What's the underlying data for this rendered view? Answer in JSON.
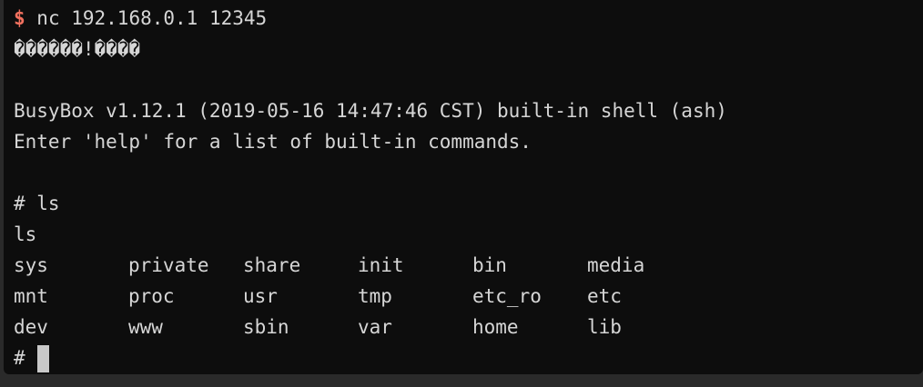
{
  "terminal": {
    "prompt_symbol": "$",
    "command": " nc 192.168.0.1 12345",
    "garbled_output": "������!����",
    "blank": "",
    "busybox_banner": "BusyBox v1.12.1 (2019-05-16 14:47:46 CST) built-in shell (ash)",
    "help_hint": "Enter 'help' for a list of built-in commands.",
    "ls_command_line": "# ls",
    "ls_echo": "ls",
    "ls_rows": [
      [
        "sys",
        "private",
        "share",
        "init",
        "bin",
        "media"
      ],
      [
        "mnt",
        "proc",
        "usr",
        "tmp",
        "etc_ro",
        "etc"
      ],
      [
        "dev",
        "www",
        "sbin",
        "var",
        "home",
        "lib"
      ]
    ],
    "final_prompt": "# "
  },
  "colors": {
    "background": "#0d0d0d",
    "text": "#d6d6d6",
    "prompt_dollar": "#f2715f",
    "cursor": "#c8c8c8"
  }
}
